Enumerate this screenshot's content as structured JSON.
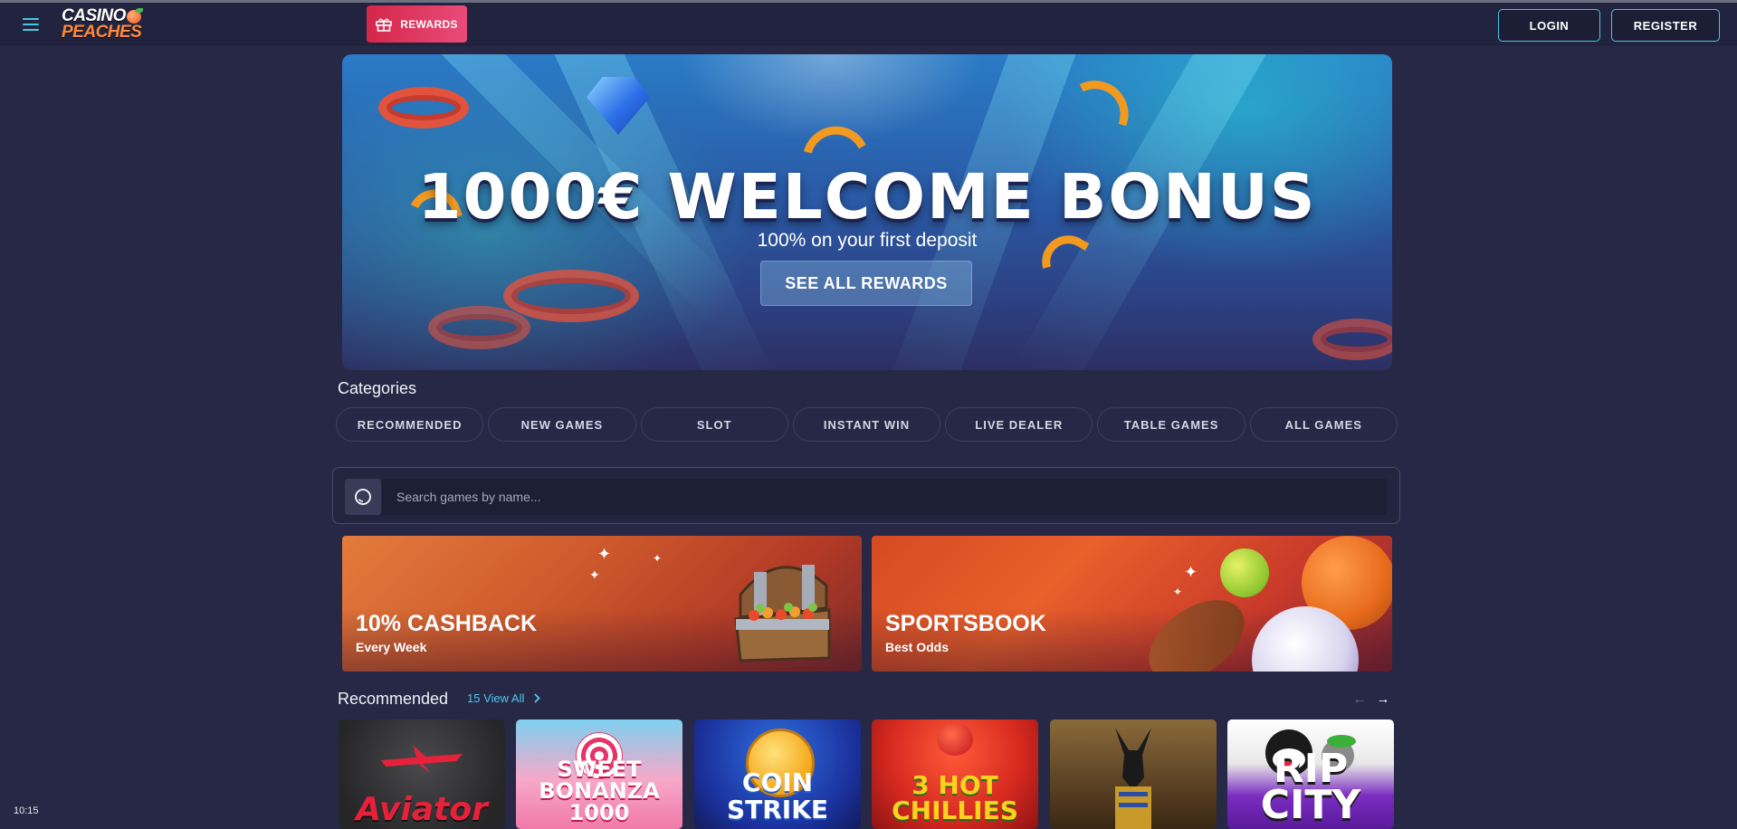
{
  "header": {
    "logo_line1": "CASINO",
    "logo_line2": "PEACHES",
    "rewards_label": "REWARDS",
    "login_label": "LOGIN",
    "register_label": "REGISTER"
  },
  "hero": {
    "title": "1000€ WELCOME BONUS",
    "subtitle": "100% on your first deposit",
    "button_label": "SEE ALL REWARDS"
  },
  "categories": {
    "title": "Categories",
    "items": [
      "RECOMMENDED",
      "NEW GAMES",
      "SLOT",
      "INSTANT WIN",
      "LIVE DEALER",
      "TABLE GAMES",
      "ALL GAMES"
    ]
  },
  "search": {
    "placeholder": "Search games by name..."
  },
  "promos": [
    {
      "title": "10% CASHBACK",
      "subtitle": "Every Week"
    },
    {
      "title": "SPORTSBOOK",
      "subtitle": "Best Odds"
    }
  ],
  "recommended": {
    "title": "Recommended",
    "view_all": "15 View All",
    "games": [
      "Aviator",
      "SWEET BONANZA 1000",
      "COIN STRIKE",
      "3 HOT CHILLIES",
      "",
      "RIP CITY"
    ]
  },
  "status": {
    "time": "10:15"
  },
  "colors": {
    "background": "#262845",
    "header": "#22243f",
    "accent_cyan": "#49c6e0",
    "rewards_pink": "#e03a62",
    "view_all_blue": "#52c8ee"
  },
  "icons": {
    "menu": "hamburger-icon",
    "rewards": "gift-icon",
    "search": "search-icon",
    "view_all": "chevron-right-icon",
    "prev": "arrow-left-icon",
    "next": "arrow-right-icon"
  }
}
